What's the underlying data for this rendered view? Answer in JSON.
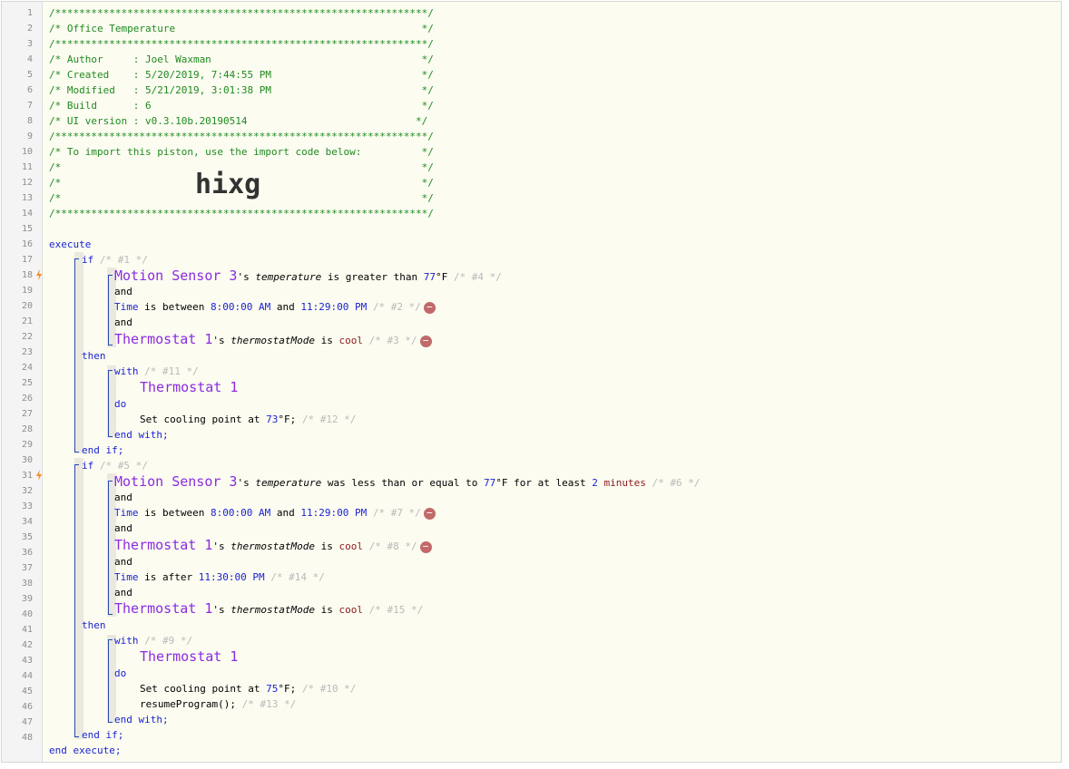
{
  "line_numbers": [
    "1",
    "2",
    "3",
    "4",
    "5",
    "6",
    "7",
    "8",
    "9",
    "10",
    "11",
    "12",
    "13",
    "14",
    "15",
    "16",
    "17",
    "18",
    "19",
    "20",
    "21",
    "22",
    "23",
    "24",
    "25",
    "26",
    "27",
    "28",
    "29",
    "30",
    "31",
    "32",
    "33",
    "34",
    "35",
    "36",
    "37",
    "38",
    "39",
    "40",
    "41",
    "42",
    "43",
    "44",
    "45",
    "46",
    "47",
    "48"
  ],
  "header": {
    "stars": "/**************************************************************/",
    "title_line": "/* Office Temperature                                         */",
    "author_line": "/* Author     : Joel Waxman                                   */",
    "created_line": "/* Created    : 5/20/2019, 7:44:55 PM                         */",
    "modified_line": "/* Modified   : 5/21/2019, 3:01:38 PM                         */",
    "build_line": "/* Build      : 6                                             */",
    "ui_line": "/* UI version : v0.3.10b.20190514                            */",
    "import_line": "/* To import this piston, use the import code below:          */",
    "blank_line": "/*                                                            */",
    "import_code": "hixg"
  },
  "kw": {
    "execute": "execute",
    "if": "if",
    "and": "and",
    "then": "then",
    "with": "with",
    "do": "do",
    "end_with": "end with;",
    "end_if": "end if;",
    "end_execute": "end execute;"
  },
  "tokens": {
    "motion_sensor": "Motion Sensor 3",
    "thermostat": "Thermostat 1",
    "possessive": "'s ",
    "temperature": "temperature",
    "thermostatMode": "thermostatMode",
    "time": "Time",
    "is_greater_than": " is greater than ",
    "is_between": " is between ",
    "and_sp": " and ",
    "is": " is ",
    "is_after": " is after ",
    "was_less_eq": " was less than or equal to ",
    "for_at_least": " for at least ",
    "cool": "cool",
    "t77": "77",
    "t73": "73",
    "t75": "75",
    "degF": "°F",
    "time_8am": "8:00:00 AM",
    "time_1129pm": "11:29:00 PM",
    "time_1130pm": "11:30:00 PM",
    "two": "2",
    "minutes": "minutes",
    "set_cooling": "Set cooling point at ",
    "semi": ";",
    "resume": "resumeProgram();",
    "remove_icon": "−"
  },
  "ids": {
    "c1": " /* #1 */",
    "c2": " /* #2 */",
    "c3": " /* #3 */",
    "c4": " /* #4 */",
    "c5": " /* #5 */",
    "c6": " /* #6 */",
    "c7": " /* #7 */",
    "c8": " /* #8 */",
    "c9": " /* #9 */",
    "c10": " /* #10 */",
    "c11": " /* #11 */",
    "c12": " /* #12 */",
    "c13": " /* #13 */",
    "c14": " /* #14 */",
    "c15": " /* #15 */"
  },
  "colors": {
    "comment": "#1f8a1f",
    "keyword": "#1a23d2",
    "device": "#8a2be2",
    "value": "#8b1a1a"
  }
}
